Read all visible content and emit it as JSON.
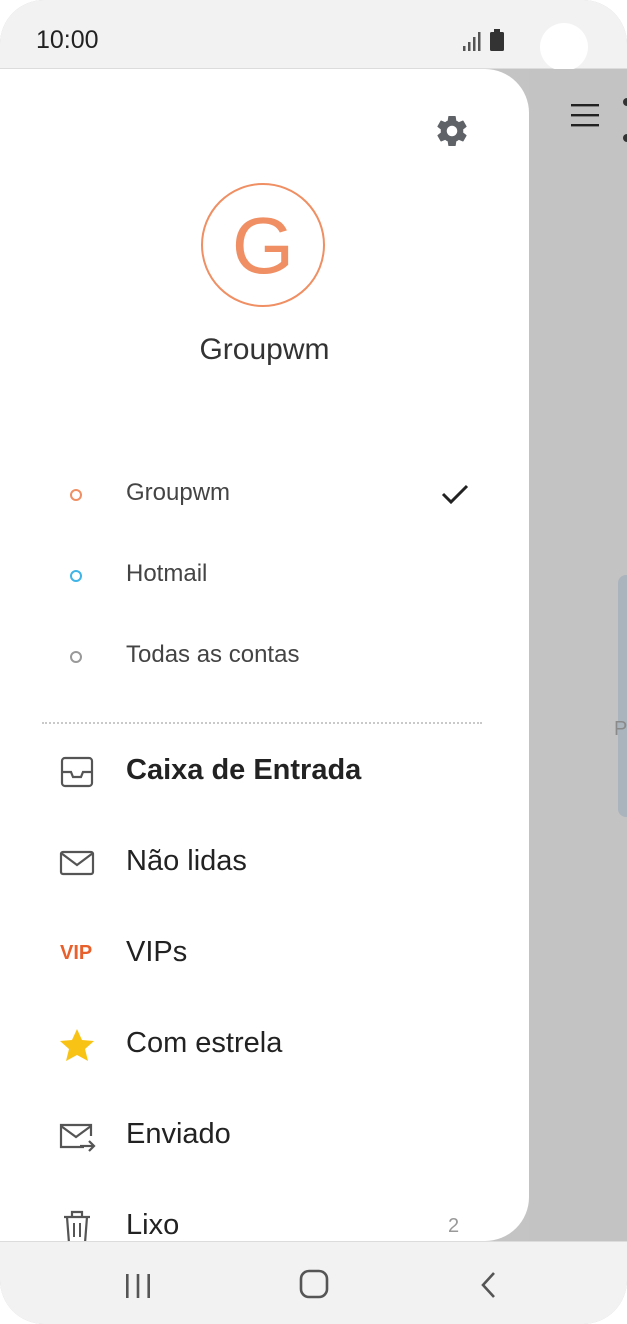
{
  "status_bar": {
    "time": "10:00"
  },
  "drawer": {
    "avatar_letter": "G",
    "account_name": "Groupwm",
    "accounts": [
      {
        "label": "Groupwm",
        "dot_color": "#ef8f63",
        "selected": true
      },
      {
        "label": "Hotmail",
        "dot_color": "#3fb4e6",
        "selected": false
      },
      {
        "label": "Todas as contas",
        "dot_color": "#999999",
        "selected": false
      }
    ],
    "folders": [
      {
        "label": "Caixa de Entrada",
        "icon": "inbox-icon",
        "bold": true
      },
      {
        "label": "Não lidas",
        "icon": "envelope-icon",
        "bold": false
      },
      {
        "label": "VIPs",
        "icon": "vip-icon",
        "icon_text": "VIP",
        "bold": false
      },
      {
        "label": "Com estrela",
        "icon": "star-icon",
        "bold": false
      },
      {
        "label": "Enviado",
        "icon": "sent-icon",
        "bold": false
      },
      {
        "label": "Lixo",
        "icon": "trash-icon",
        "bold": false,
        "count": "2"
      }
    ]
  },
  "background_app": {
    "peek_letter": "P"
  },
  "colors": {
    "accent": "#ef8f63",
    "vip": "#e8602c",
    "star": "#f9c316"
  }
}
